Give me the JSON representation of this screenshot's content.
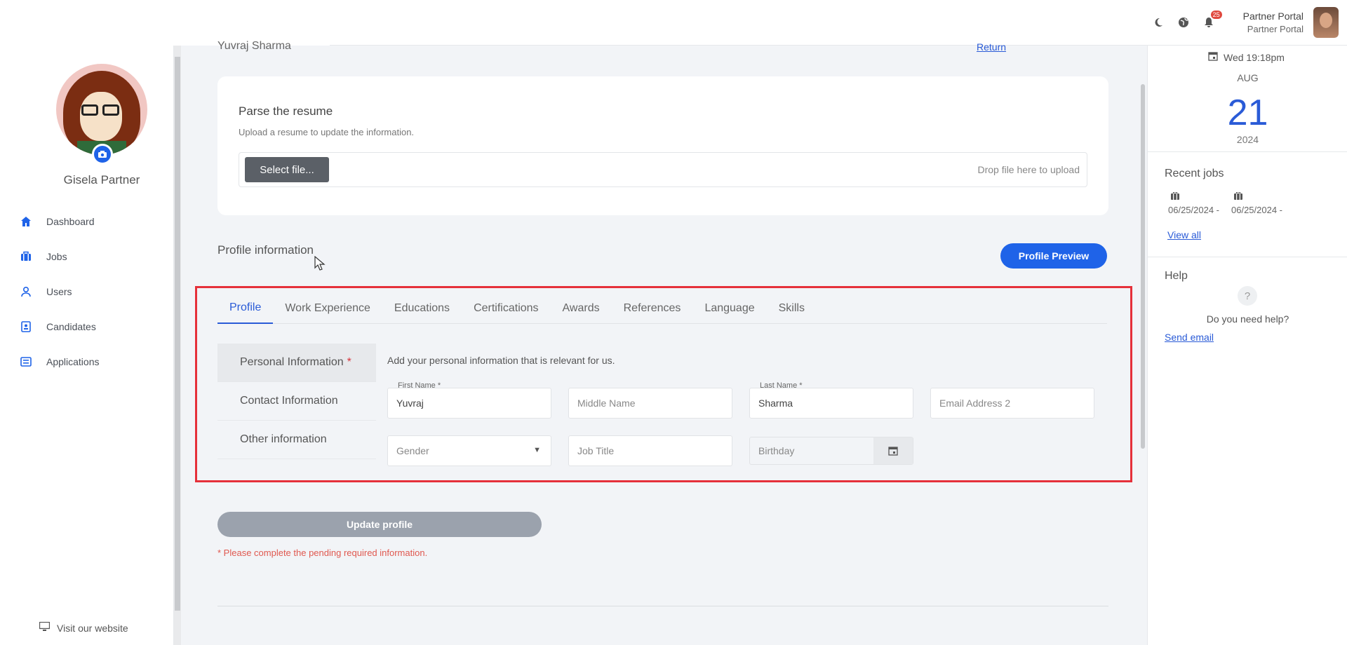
{
  "topbar": {
    "notif_count": "25",
    "portal_title": "Partner Portal",
    "portal_subtitle": "Partner Portal"
  },
  "sidebar": {
    "user_name": "Gisela Partner",
    "items": [
      {
        "label": "Dashboard",
        "icon": "home-icon"
      },
      {
        "label": "Jobs",
        "icon": "briefcase-icon"
      },
      {
        "label": "Users",
        "icon": "user-icon"
      },
      {
        "label": "Candidates",
        "icon": "id-card-icon"
      },
      {
        "label": "Applications",
        "icon": "list-icon"
      }
    ],
    "visit_label": "Visit our website"
  },
  "main": {
    "candidate_name": "Yuvraj Sharma",
    "return_label": "Return",
    "parse": {
      "title": "Parse the resume",
      "subtitle": "Upload a resume to update the information.",
      "select_label": "Select file...",
      "drop_hint": "Drop file here to upload"
    },
    "profile_heading": "Profile information",
    "preview_label": "Profile Preview",
    "tabs": [
      "Profile",
      "Work Experience",
      "Educations",
      "Certifications",
      "Awards",
      "References",
      "Language",
      "Skills"
    ],
    "subnav": {
      "personal": "Personal Information",
      "required_mark": "*",
      "contact": "Contact Information",
      "other": "Other information"
    },
    "form": {
      "hint": "Add your personal information that is relevant for us.",
      "first_name_label": "First Name *",
      "first_name_value": "Yuvraj",
      "middle_name_placeholder": "Middle Name",
      "last_name_label": "Last Name *",
      "last_name_value": "Sharma",
      "email2_placeholder": "Email Address 2",
      "gender_placeholder": "Gender",
      "job_title_placeholder": "Job Title",
      "birthday_placeholder": "Birthday"
    },
    "update_label": "Update profile",
    "pending_note": "* Please complete the pending required information."
  },
  "right": {
    "datetime": "Wed 19:18pm",
    "month": "AUG",
    "day": "21",
    "year": "2024",
    "recent_title": "Recent jobs",
    "job1": "06/25/2024 -",
    "job2": "06/25/2024 -",
    "view_all": "View all",
    "help_title": "Help",
    "help_q": "?",
    "help_text": "Do you need help?",
    "send_email": "Send email"
  },
  "colors": {
    "accent": "#1f63e8",
    "highlight_frame": "#e5303a",
    "required": "#d8343c",
    "disabled_button": "#9ba2ad"
  }
}
